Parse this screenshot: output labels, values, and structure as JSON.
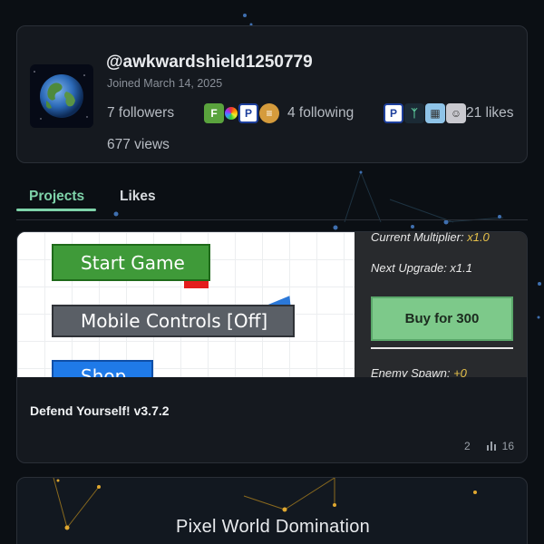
{
  "profile": {
    "username": "@awkwardshield1250779",
    "joined": "Joined March 14, 2025",
    "followers": "7 followers",
    "following": "4 following",
    "likes": "21 likes",
    "views": "677 views",
    "follower_avatars": [
      "F",
      "rainbow",
      "P",
      "burger"
    ],
    "following_avatars": [
      "P",
      "tree",
      "face"
    ],
    "avatar_icon": "earth-icon"
  },
  "tabs": [
    {
      "label": "Projects",
      "active": true
    },
    {
      "label": "Likes",
      "active": false
    }
  ],
  "project": {
    "title": "Defend Yourself! v3.7.2",
    "comments": "2",
    "plays": "16",
    "thumbnail": {
      "start_game": "Start Game",
      "mobile_controls": "Mobile Controls [Off]",
      "shop": "Shop",
      "current_multiplier_label": "Current Multiplier:",
      "current_multiplier_value": "x1.0",
      "next_upgrade": "Next Upgrade: x1.1",
      "buy": "Buy for 300",
      "enemy_spawn_label": "Enemy Spawn:",
      "enemy_spawn_value": "+0"
    }
  },
  "project2": {
    "title": "Pixel World Domination"
  },
  "colors": {
    "accent": "#7ed3a9",
    "background": "#0b0f14",
    "card": "#15191f"
  }
}
